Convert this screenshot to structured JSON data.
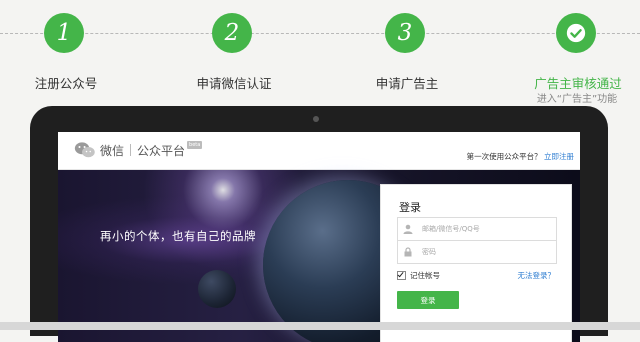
{
  "steps": [
    {
      "number": "1",
      "label": "注册公众号"
    },
    {
      "number": "2",
      "label": "申请微信认证"
    },
    {
      "number": "3",
      "label": "申请广告主"
    },
    {
      "label": "广告主审核通过",
      "sub": "进入“广告主”功能"
    }
  ],
  "header": {
    "brand": "微信",
    "product": "公众平台",
    "beta": "beta",
    "first_time_prompt": "第一次使用公众平台？",
    "register_link": "立即注册"
  },
  "hero": {
    "slogan": "再小的个体，也有自己的品牌"
  },
  "login": {
    "title": "登录",
    "account_placeholder": "邮箱/微信号/QQ号",
    "password_placeholder": "密码",
    "remember_label": "记住帐号",
    "forgot_label": "无法登录？",
    "submit_label": "登录"
  },
  "colors": {
    "accent": "#44b549",
    "link": "#2e7dd1"
  }
}
